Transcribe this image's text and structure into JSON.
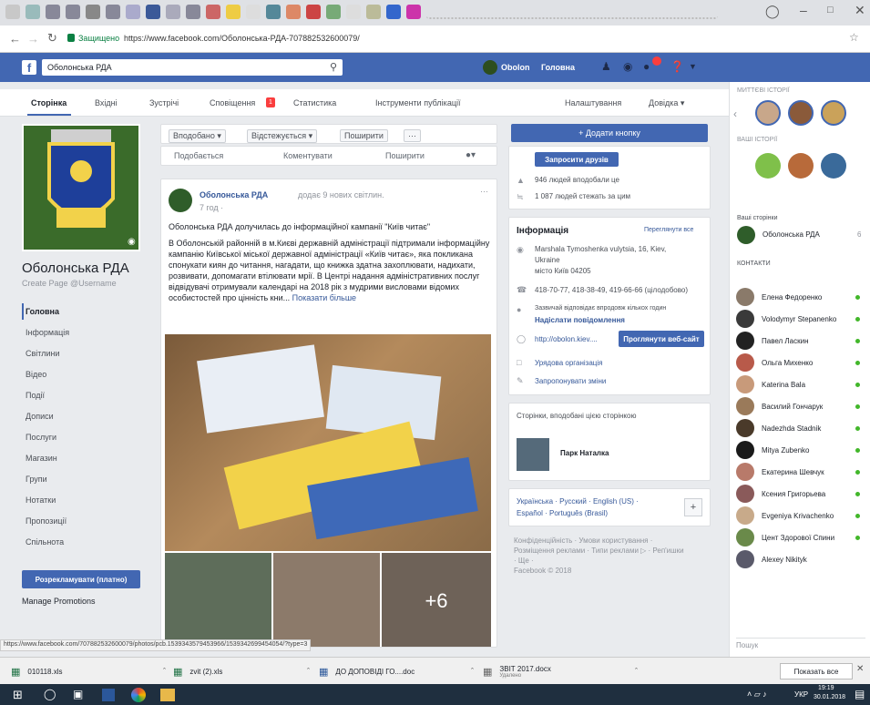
{
  "browser": {
    "url_prefix": "Защищено",
    "url": "https://www.facebook.com/Оболонська-РДА-707882532600079/"
  },
  "fb": {
    "search_value": "Оболонська РДА",
    "user": "Obolon",
    "home": "Головна"
  },
  "subnav": {
    "tabs": [
      "Сторінка",
      "Вхідні",
      "Зустрічі",
      "Сповіщення",
      "Статистика",
      "Інструменти публікації"
    ],
    "notif_badge": "1",
    "settings": "Налаштування",
    "help": "Довідка ▾"
  },
  "left": {
    "page_name": "Оболонська РДА",
    "username": "Create Page @Username",
    "items": [
      "Головна",
      "Інформація",
      "Світлини",
      "Відео",
      "Події",
      "Дописи",
      "Послуги",
      "Магазин",
      "Групи",
      "Нотатки",
      "Пропозиції",
      "Спільнота"
    ],
    "promote": "Розрекламувати (платно)",
    "manage": "Manage Promotions"
  },
  "actions": {
    "liked": "Вподобано ▾",
    "following": "Відстежується ▾",
    "share": "Поширити",
    "more": "···"
  },
  "postbar": {
    "like": "Подобається",
    "comment": "Коментувати",
    "share": "Поширити"
  },
  "post": {
    "author": "Оболонська РДА",
    "action": "додає 9 нових світлин.",
    "time": "7 год ·",
    "title": "Оболонська РДА долучилась до інформаційної кампанії \"Київ читає\"",
    "body": "В Оболонській районній в м.Києві державній адміністрації підтримали інформаційну кампанію Київської міської державної адміністрації «Київ читає», яка покликана спонукати киян до читання, нагадати, що книжка здатна захоплювати, надихати, розвивати, допомагати втілювати мрії. В Центрі надання адміністративних послуг відвідувачі отримували календарі на 2018 рік з мудрими висловами відомих особистостей про цінність кни...",
    "more": "Показати більше",
    "plus": "+6"
  },
  "right": {
    "add_button": "+ Додати кнопку",
    "invite": "Запросити друзів",
    "likes": "946 людей вподобали це",
    "follows": "1 087 людей стежать за цим",
    "info_title": "Інформація",
    "view_all": "Переглянути все",
    "address1": "Marshala Tymoshenka vulytsia, 16, Kiev,",
    "address2": "Ukraine",
    "address3": "місто Київ 04205",
    "phones": "418-70-77, 418-38-49, 419-66-66 (цілодобово)",
    "reply1": "Зазвичай відповідає впродовж кількох годин",
    "reply2": "Надіслати повідомлення",
    "site": "http://obolon.kiev....",
    "visit": "Проглянути веб-сайт",
    "org": "Урядова організація",
    "suggest": "Запропонувати зміни",
    "liked_title": "Сторінки, вподобані цією сторінкою",
    "liked_page": "Парк Наталка",
    "langs1": "Українська · Русский · English (US) ·",
    "langs2": "Español · Português (Brasil)",
    "footer1": "Конфіденційність · Умови користування ·",
    "footer2": "Розміщення реклами · Типи реклами ▷ · Реп'ишки",
    "footer3": "· Ще ·",
    "footer4": "Facebook © 2018"
  },
  "chat": {
    "stories": "МИТТЄВІ ІСТОРІЇ",
    "yours": "ВАШІ ІСТОРІЇ",
    "pages": "Ваші сторінки",
    "page1": "Оболонська РДА",
    "page1_count": "6",
    "contacts": "КОНТАКТИ",
    "people": [
      "Елена Федоренко",
      "Volodymyr Stepanenko",
      "Павел Ласкин",
      "Ольга Михенко",
      "Katerina Bala",
      "Василий Гончарук",
      "Nadezhda Stadnik",
      "Mitya Zubenko",
      "Екатерина Шевчук",
      "Ксения Григорьева",
      "Evgeniya Krivachenko",
      "Цент Здорової Спини",
      "Alexey Nikityk"
    ],
    "search": "Пошук"
  },
  "status_url": "https://www.facebook.com/707882532600079/photos/pcb.1539343579453966/1539342699454054/?type=3",
  "downloads": [
    "010118.xls",
    "zvit (2).xls",
    "ДО ДОПОВІДІ ГО....doc",
    "ЗВІТ 2017.docx"
  ],
  "dl_sub": "Удалено",
  "show_all": "Показать все",
  "clock": {
    "time": "19:19",
    "date": "30.01.2018",
    "lang": "УКР"
  }
}
